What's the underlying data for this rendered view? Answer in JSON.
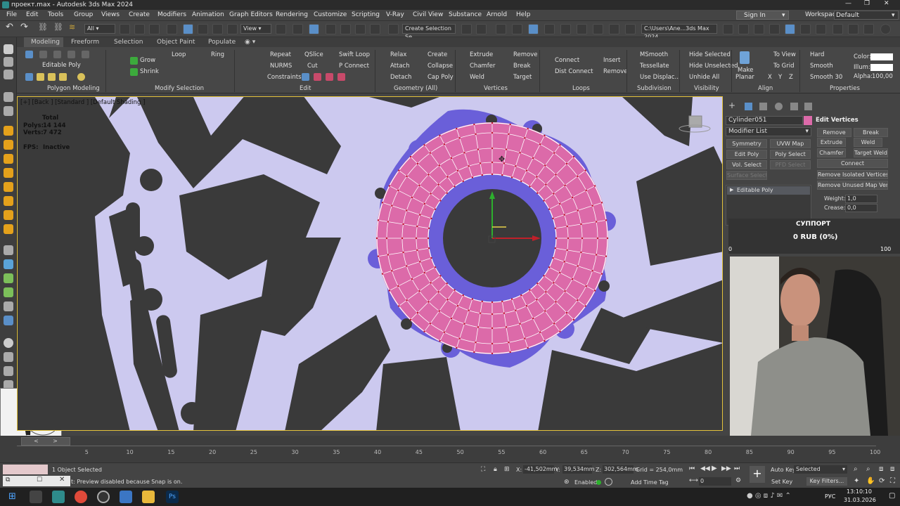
{
  "window": {
    "title": "проект.max - Autodesk 3ds Max 2024"
  },
  "menu": [
    "File",
    "Edit",
    "Tools",
    "Group",
    "Views",
    "Create",
    "Modifiers",
    "Animation",
    "Graph Editors",
    "Rendering",
    "Customize",
    "Scripting",
    "V-Ray",
    "Civil View",
    "Substance",
    "Arnold",
    "Help"
  ],
  "account": {
    "sign_in": "Sign In",
    "workspaces_label": "Workspaces:",
    "workspace": "Default"
  },
  "toolbar": {
    "filter": "All",
    "view": "View",
    "selection_set": "Create Selection Se",
    "path": "C:\\Users\\Ane...3ds Max 2024"
  },
  "ribbon_tabs": [
    "Modeling",
    "Freeform",
    "Selection",
    "Object Paint",
    "Populate"
  ],
  "ribbon": {
    "mode_label": "Editable Poly",
    "poly_modeling": "Polygon Modeling",
    "grow": "Grow",
    "shrink": "Shrink",
    "loop": "Loop",
    "ring": "Ring",
    "modify_selection": "Modify Selection",
    "repeat": "Repeat",
    "qslice": "QSlice",
    "swift_loop": "Swift Loop",
    "nurms": "NURMS",
    "cut": "Cut",
    "p_connect": "P Connect",
    "constraints": "Constraints:",
    "edit": "Edit",
    "relax": "Relax",
    "create": "Create",
    "attach": "Attach",
    "collapse": "Collapse",
    "detach": "Detach",
    "cap_poly": "Cap Poly",
    "geometry": "Geometry (All)",
    "extrude": "Extrude",
    "remove": "Remove",
    "chamfer": "Chamfer",
    "break": "Break",
    "weld": "Weld",
    "target": "Target",
    "vertices": "Vertices",
    "connect": "Connect",
    "dist_connect": "Dist Connect",
    "insert": "Insert",
    "remove2": "Remove",
    "loops": "Loops",
    "msmooth": "MSmooth",
    "tessellate": "Tessellate",
    "use_displac": "Use Displac...",
    "subdivision": "Subdivision",
    "hide_selected": "Hide Selected",
    "hide_unselected": "Hide Unselected",
    "unhide_all": "Unhide All",
    "visibility": "Visibility",
    "make_planar": "Make",
    "make_planar2": "Planar",
    "to_view": "To View",
    "to_grid": "To Grid",
    "x": "X",
    "y": "Y",
    "z": "Z",
    "align": "Align",
    "hard": "Hard",
    "smooth": "Smooth",
    "smooth30": "Smooth 30",
    "color": "Color:",
    "illum": "Illum:",
    "alpha": "Alpha:",
    "alpha_val": "100,00",
    "properties": "Properties"
  },
  "viewport": {
    "label": "[+] [Back ] [Standard ] [Default Shading ]",
    "total": "Total",
    "polys_label": "Polys:",
    "polys": "14 144",
    "verts_label": "Verts:",
    "verts": "7 472",
    "fps_label": "FPS:",
    "fps": "Inactive"
  },
  "command_panel": {
    "object_name": "Cylinder051",
    "modifier_list": "Modifier List",
    "buttons": [
      "Symmetry",
      "UVW Map",
      "Edit Poly",
      "Poly Select",
      "Vol. Select",
      "PFD Select",
      "Surface Select"
    ],
    "stack_item": "Editable Poly",
    "edit_vertices": "Edit Vertices",
    "remove": "Remove",
    "break": "Break",
    "extrude": "Extrude",
    "weld": "Weld",
    "chamfer": "Chamfer",
    "target_weld": "Target Weld",
    "connect": "Connect",
    "remove_isolated": "Remove Isolated Vertices",
    "remove_unused": "Remove Unused Map Verts",
    "weight_label": "Weight:",
    "weight": "1,0",
    "crease_label": "Crease:",
    "crease": "0,0"
  },
  "donation": {
    "title": "СУППОРТ",
    "amount": "0 RUB (0%)",
    "min": "0",
    "max": "100",
    "progress": 0
  },
  "timeline": {
    "ticks": [
      "5",
      "10",
      "15",
      "20",
      "25",
      "30",
      "35",
      "40",
      "45",
      "50",
      "55",
      "60",
      "65",
      "70",
      "75",
      "80",
      "85",
      "90",
      "95",
      "100"
    ],
    "frame": "0 / 100"
  },
  "status": {
    "selected": "1 Object Selected",
    "prompt": "t: Preview disabled because Snap is on.",
    "x_label": "X:",
    "x": "-41,502mm",
    "y_label": "Y:",
    "y": "39,534mm",
    "z_label": "Z:",
    "z": "302,564mm",
    "grid": "Grid = 254,0mm",
    "enabled": "Enabled:",
    "add_time_tag": "Add Time Tag",
    "auto_key": "Auto Key",
    "set_key": "Set Key",
    "key_mode": "Selected",
    "key_filters": "Key Filters...",
    "frame_field": "0"
  },
  "taskbar": {
    "lang": "РУС",
    "time": "13:10:10",
    "date": "31.03.2026"
  },
  "colors": {
    "accent": "#5a8fc8",
    "viewport_bg": "#ccc9ef",
    "part_pink": "#dc6aa9",
    "part_purple": "#6a5fd9",
    "dark_shape": "#3a3a3a"
  }
}
